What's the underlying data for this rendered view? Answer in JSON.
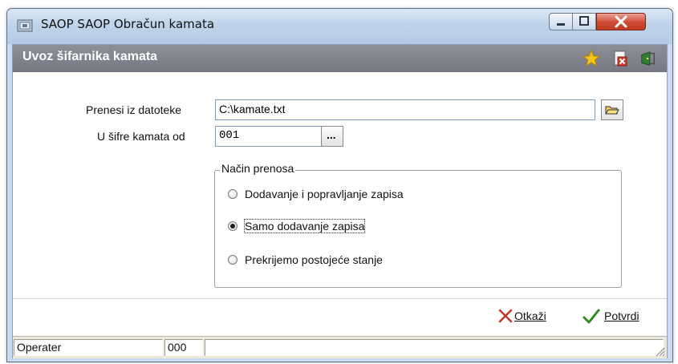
{
  "window": {
    "title": "SAOP SAOP Obračun kamata",
    "controls": {
      "minimize": "minimize",
      "maximize": "maximize",
      "close": "close"
    }
  },
  "header": {
    "title": "Uvoz šifarnika kamata",
    "icons": [
      "star-icon",
      "close-document-icon",
      "exit-icon"
    ]
  },
  "form": {
    "file_label": "Prenesi iz datoteke",
    "file_value": "C:\\kamate.txt",
    "code_label": "U šifre kamata od",
    "code_value": "001",
    "browse_label": "..."
  },
  "transfer": {
    "legend": "Način prenosa",
    "options": [
      {
        "label": "Dodavanje i popravljanje zapisa",
        "checked": false
      },
      {
        "label": "Samo dodavanje zapisa",
        "checked": true
      },
      {
        "label": "Prekrijemo postojeće stanje",
        "checked": false
      }
    ]
  },
  "actions": {
    "cancel_label": "Otkaži",
    "confirm_label": "Potvrdi"
  },
  "status": {
    "user_label": "Operater",
    "user_code": "000"
  },
  "colors": {
    "header_bg": "#7f828a",
    "titlebar_bg": "#c9dcef",
    "close_red": "#c94a32",
    "cancel_x": "#c0392b",
    "confirm_check": "#2e8b1e"
  }
}
